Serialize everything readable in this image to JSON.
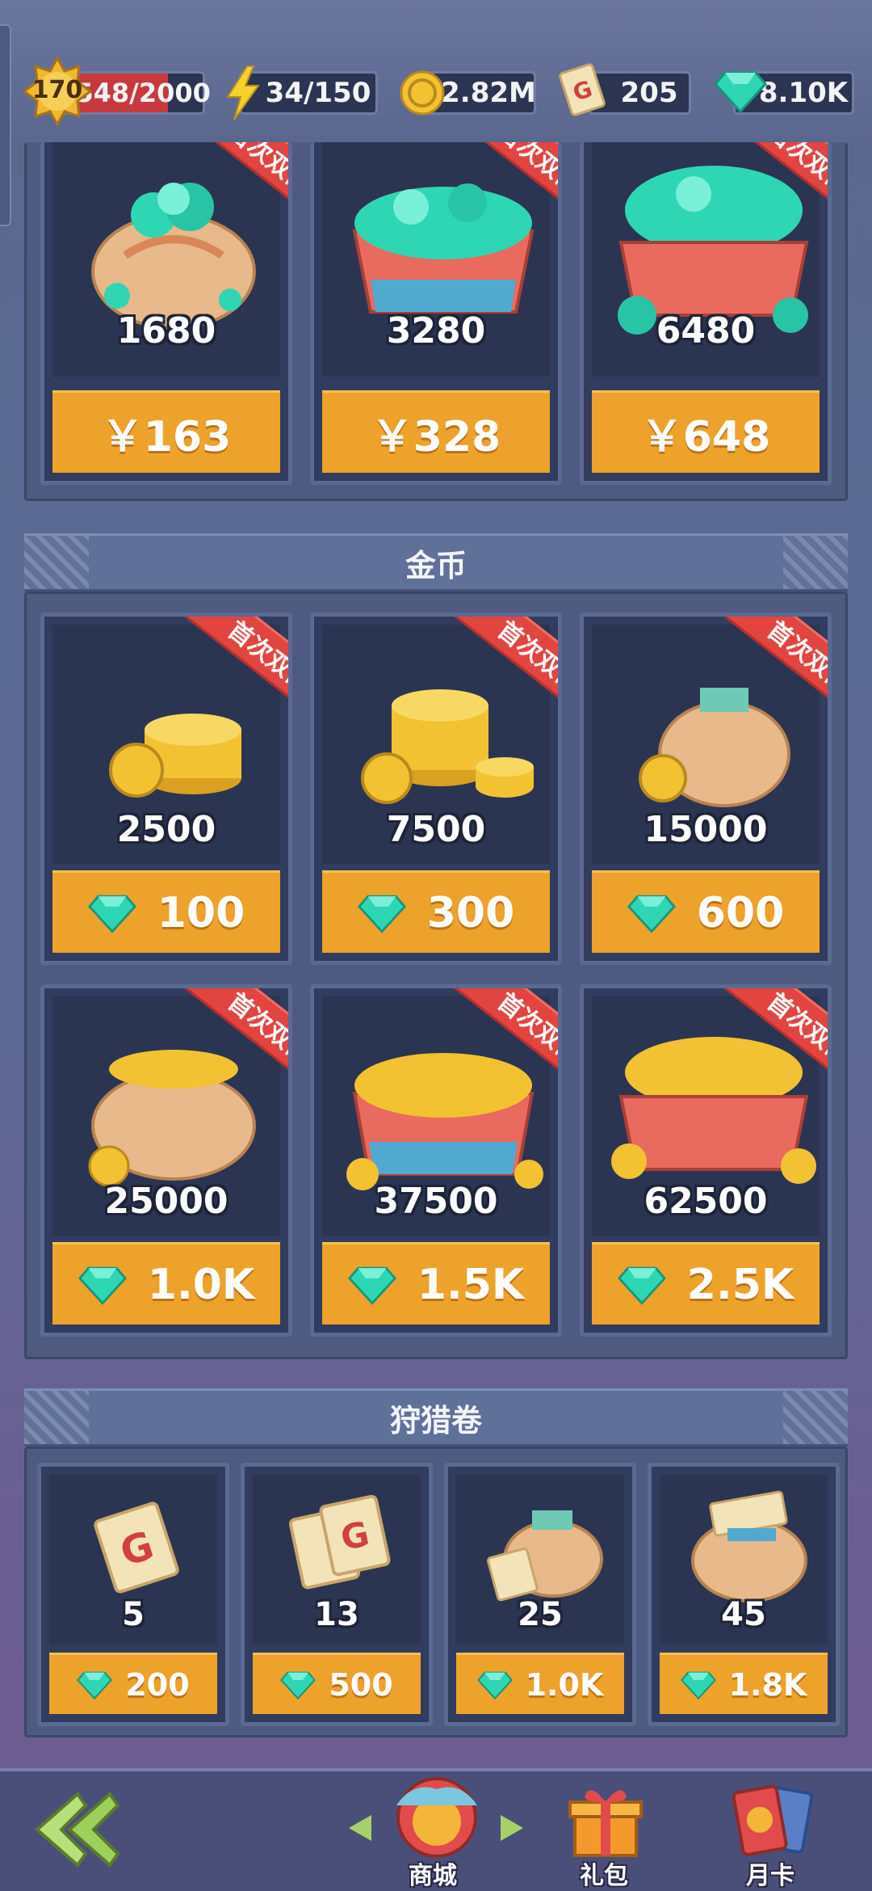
{
  "status": {
    "level": "170",
    "xp": "1548/2000",
    "energy": "34/150",
    "coins": "2.82M",
    "tickets": "205",
    "gems": "8.10K"
  },
  "gem_packs": [
    {
      "amount": "1680",
      "price": "￥163",
      "badge": "首次双倍"
    },
    {
      "amount": "3280",
      "price": "￥328",
      "badge": "首次双倍"
    },
    {
      "amount": "6480",
      "price": "￥648",
      "badge": "首次双倍"
    }
  ],
  "coin_section": {
    "title": "金币",
    "items": [
      {
        "amount": "2500",
        "price": "100",
        "badge": "首次双倍"
      },
      {
        "amount": "7500",
        "price": "300",
        "badge": "首次双倍"
      },
      {
        "amount": "15000",
        "price": "600",
        "badge": "首次双倍"
      },
      {
        "amount": "25000",
        "price": "1.0K",
        "badge": "首次双倍"
      },
      {
        "amount": "37500",
        "price": "1.5K",
        "badge": "首次双倍"
      },
      {
        "amount": "62500",
        "price": "2.5K",
        "badge": "首次双倍"
      }
    ]
  },
  "ticket_section": {
    "title": "狩猎卷",
    "items": [
      {
        "amount": "5",
        "price": "200"
      },
      {
        "amount": "13",
        "price": "500"
      },
      {
        "amount": "25",
        "price": "1.0K"
      },
      {
        "amount": "45",
        "price": "1.8K"
      }
    ]
  },
  "nav": {
    "shop": "商城",
    "gift": "礼包",
    "monthly": "月卡"
  },
  "colors": {
    "button_orange": "#eda22b",
    "ribbon_red": "#e2453f",
    "gem_teal": "#2fd6b4",
    "coin_gold": "#f2c232"
  }
}
